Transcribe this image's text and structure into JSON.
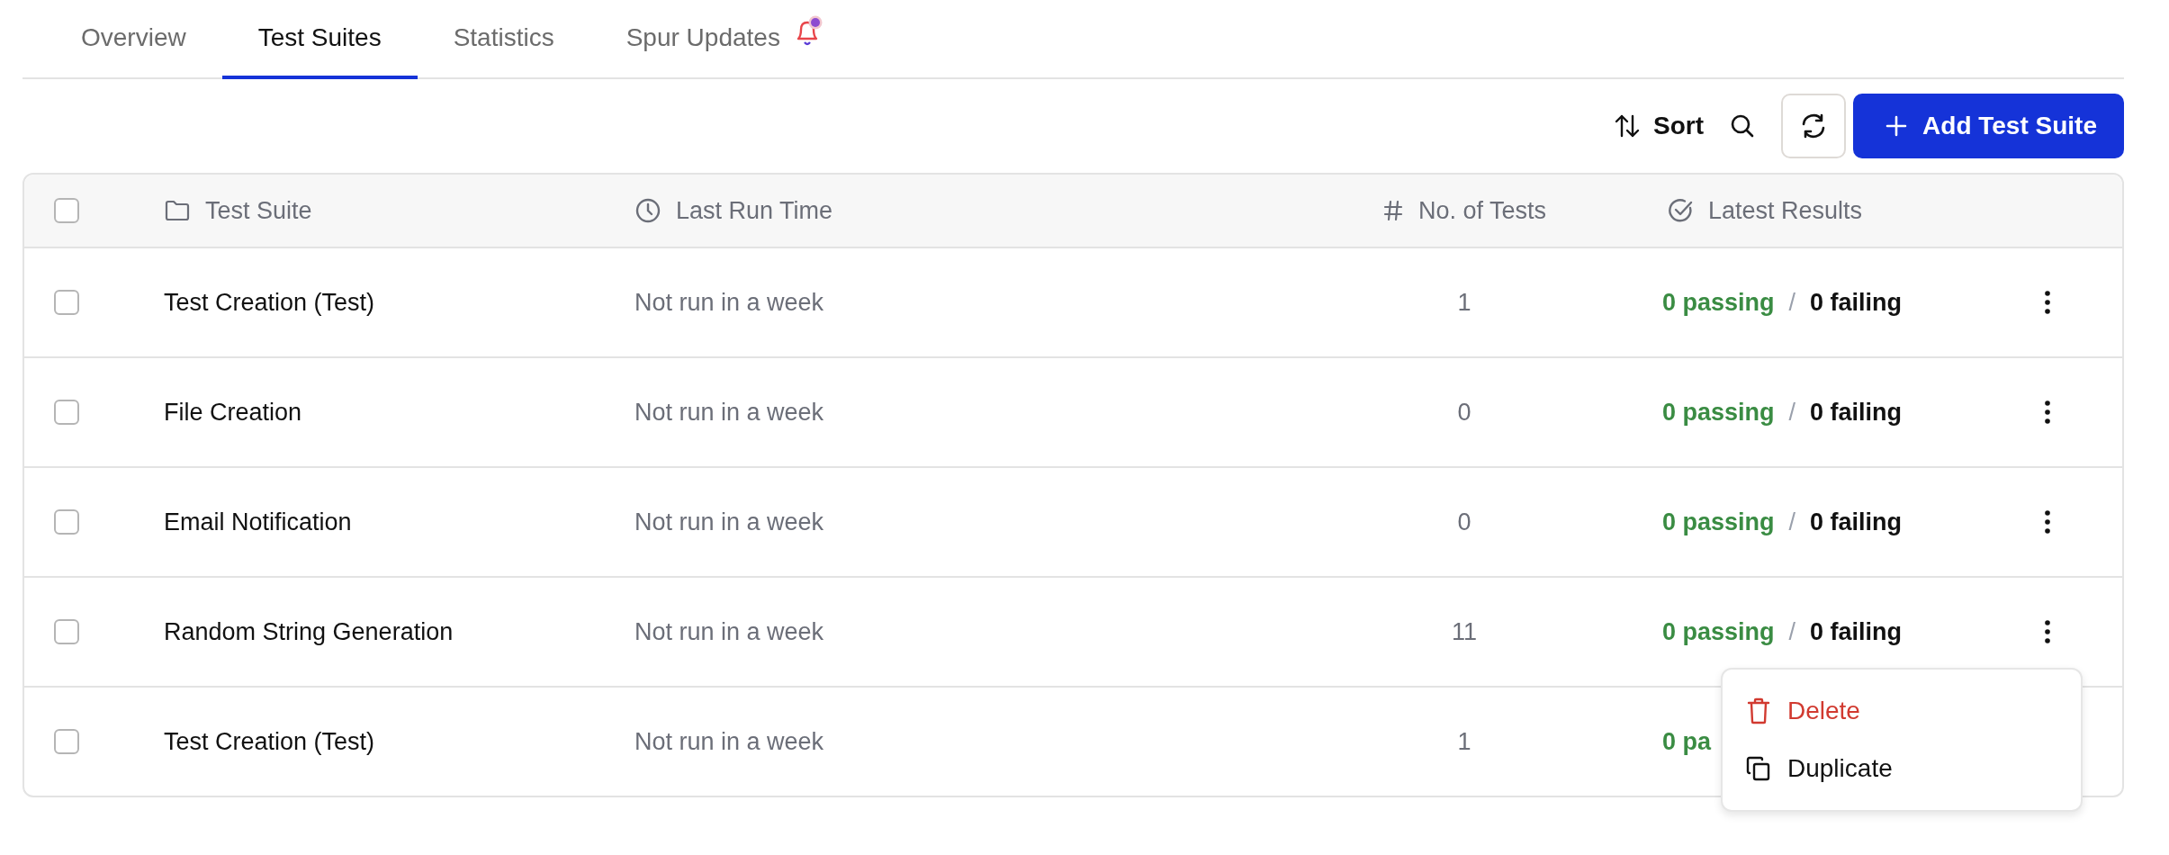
{
  "tabs": [
    {
      "label": "Overview",
      "selected": false,
      "notification": false
    },
    {
      "label": "Test Suites",
      "selected": true,
      "notification": false
    },
    {
      "label": "Statistics",
      "selected": false,
      "notification": false
    },
    {
      "label": "Spur Updates",
      "selected": false,
      "notification": true
    }
  ],
  "toolbar": {
    "sort_label": "Sort",
    "add_label": "Add Test Suite"
  },
  "table": {
    "columns": [
      {
        "label": "Test Suite",
        "kind": "folder"
      },
      {
        "label": "Last Run Time",
        "kind": "clock"
      },
      {
        "label": "No. of Tests",
        "kind": "hash"
      },
      {
        "label": "Latest Results",
        "kind": "check"
      }
    ],
    "header_checked": false,
    "rows": [
      {
        "checked": false,
        "name": "Test Creation (Test)",
        "last_run": "Not run in a week",
        "tests": "1",
        "passing": "0 passing",
        "separator": "/",
        "failing": "0 failing"
      },
      {
        "checked": false,
        "name": "File Creation",
        "last_run": "Not run in a week",
        "tests": "0",
        "passing": "0 passing",
        "separator": "/",
        "failing": "0 failing"
      },
      {
        "checked": false,
        "name": "Email Notification",
        "last_run": "Not run in a week",
        "tests": "0",
        "passing": "0 passing",
        "separator": "/",
        "failing": "0 failing"
      },
      {
        "checked": false,
        "name": "Random String Generation",
        "last_run": "Not run in a week",
        "tests": "11",
        "passing": "0 passing",
        "separator": "/",
        "failing": "0 failing"
      },
      {
        "checked": false,
        "name": "Test Creation (Test)",
        "last_run": "Not run in a week",
        "tests": "1",
        "passing": "0 pa"
      }
    ]
  },
  "context_menu": {
    "items": [
      {
        "label": "Delete",
        "kind": "delete"
      },
      {
        "label": "Duplicate",
        "kind": "duplicate"
      }
    ]
  }
}
